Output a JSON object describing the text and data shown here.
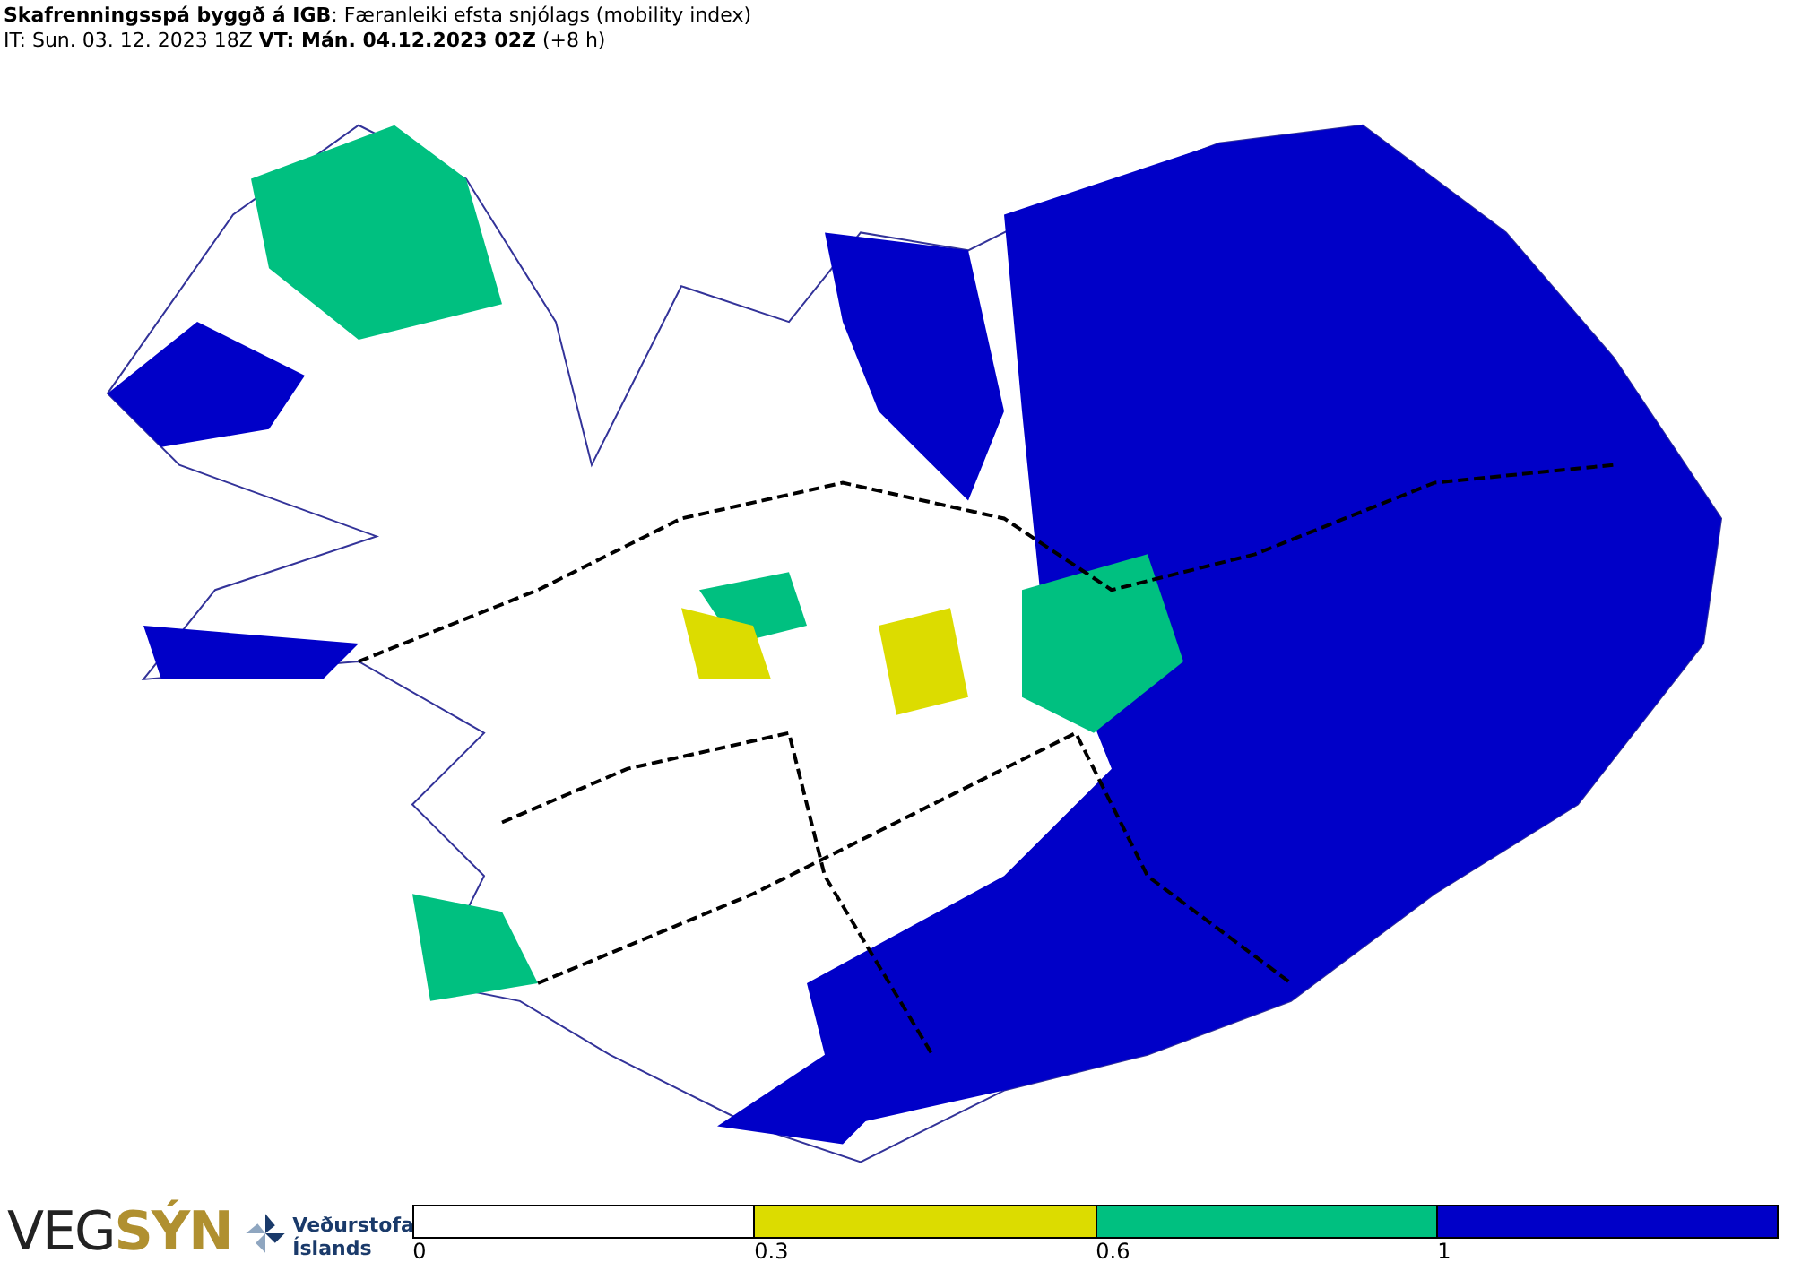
{
  "header": {
    "title": "**Skafrenningsspá byggð á IGB**: Færanleiki efsta snjólags (mobility index)",
    "times": "IT: Sun. 03. 12. 2023 18Z **VT: Mán. 04.12.2023 02Z** (+8 h)"
  },
  "logos": {
    "vegsyn": [
      "VEG",
      "SÝN"
    ],
    "vedurstofa": [
      "Veðurstofa",
      "Íslands"
    ]
  },
  "legend": [
    {
      "label": "0",
      "color": "#ffffff"
    },
    {
      "label": "0.3",
      "color": "#dcdc00"
    },
    {
      "label": "0.6",
      "color": "#00c080"
    },
    {
      "label": "1",
      "color": "#0000c8"
    }
  ]
}
